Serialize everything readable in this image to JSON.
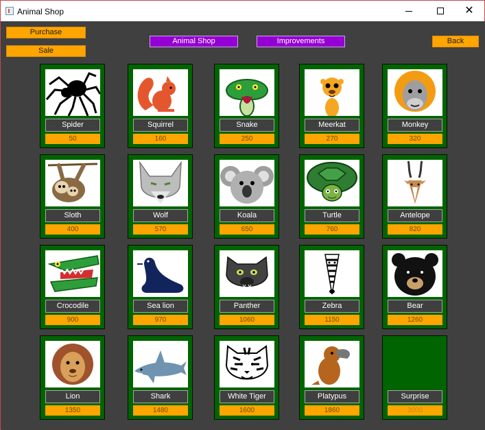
{
  "window": {
    "title": "Animal Shop"
  },
  "toolbar": {
    "purchase": "Purchase",
    "sale": "Sale",
    "animal_shop": "Animal Shop",
    "improvements": "Improvements",
    "back": "Back"
  },
  "colors": {
    "card_bg": "#006400",
    "price_bg": "#ffa500",
    "purple_btn": "#9400d3",
    "window_bg": "#404040"
  },
  "animals": [
    {
      "name": "Spider",
      "price": "50",
      "icon": "spider-icon"
    },
    {
      "name": "Squirrel",
      "price": "160",
      "icon": "squirrel-icon"
    },
    {
      "name": "Snake",
      "price": "250",
      "icon": "snake-icon"
    },
    {
      "name": "Meerkat",
      "price": "270",
      "icon": "meerkat-icon"
    },
    {
      "name": "Monkey",
      "price": "320",
      "icon": "monkey-icon"
    },
    {
      "name": "Sloth",
      "price": "400",
      "icon": "sloth-icon"
    },
    {
      "name": "Wolf",
      "price": "570",
      "icon": "wolf-icon"
    },
    {
      "name": "Koala",
      "price": "650",
      "icon": "koala-icon"
    },
    {
      "name": "Turtle",
      "price": "760",
      "icon": "turtle-icon"
    },
    {
      "name": "Antelope",
      "price": "820",
      "icon": "antelope-icon"
    },
    {
      "name": "Crocodile",
      "price": "900",
      "icon": "crocodile-icon"
    },
    {
      "name": "Sea lion",
      "price": "970",
      "icon": "sea-lion-icon"
    },
    {
      "name": "Panther",
      "price": "1060",
      "icon": "panther-icon"
    },
    {
      "name": "Zebra",
      "price": "1150",
      "icon": "zebra-icon"
    },
    {
      "name": "Bear",
      "price": "1260",
      "icon": "bear-icon"
    },
    {
      "name": "Lion",
      "price": "1350",
      "icon": "lion-icon"
    },
    {
      "name": "Shark",
      "price": "1480",
      "icon": "shark-icon"
    },
    {
      "name": "White Tiger",
      "price": "1600",
      "icon": "white-tiger-icon"
    },
    {
      "name": "Platypus",
      "price": "1860",
      "icon": "platypus-icon"
    },
    {
      "name": "Surprise",
      "price": "3000",
      "icon": "",
      "locked": true
    }
  ]
}
